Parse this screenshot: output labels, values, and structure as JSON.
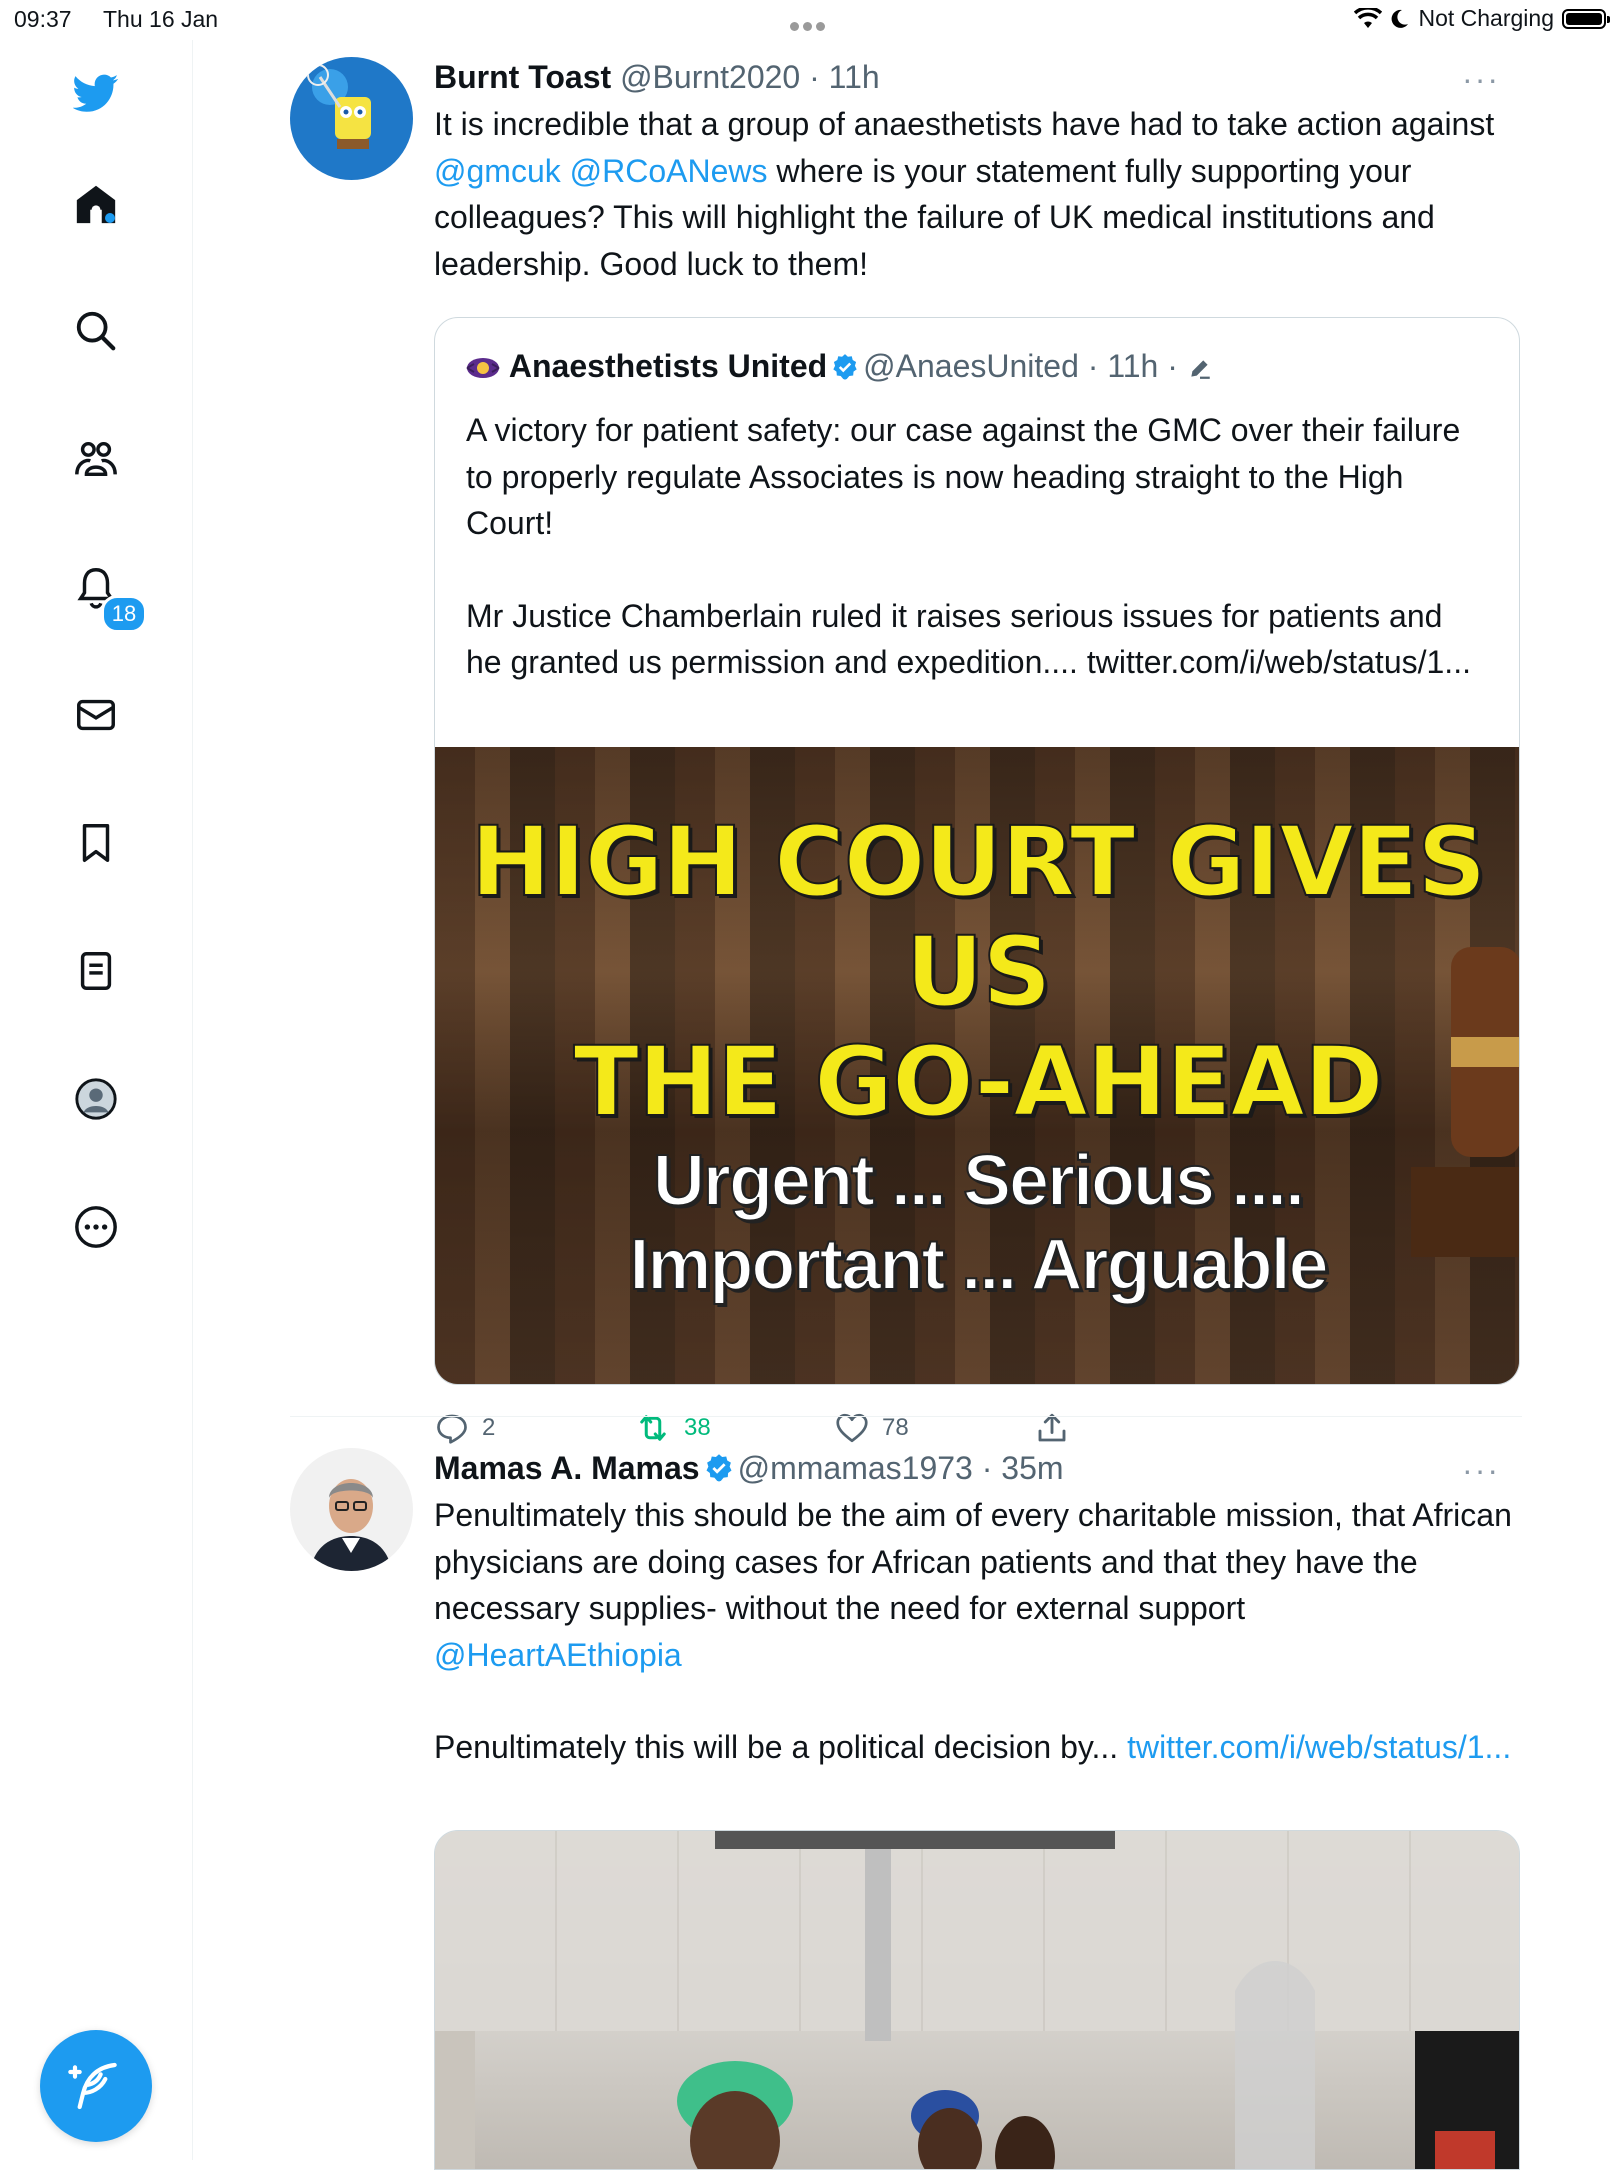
{
  "status_bar": {
    "time": "09:37",
    "date": "Thu 16 Jan",
    "charging": "Not Charging"
  },
  "sidebar": {
    "items": [
      {
        "icon": "twitter-bird-icon"
      },
      {
        "icon": "home-icon"
      },
      {
        "icon": "search-icon"
      },
      {
        "icon": "communities-icon"
      },
      {
        "icon": "notifications-icon",
        "badge": "18"
      },
      {
        "icon": "messages-icon"
      },
      {
        "icon": "bookmarks-icon"
      },
      {
        "icon": "lists-icon"
      },
      {
        "icon": "profile-icon"
      },
      {
        "icon": "more-icon"
      }
    ],
    "compose_icon": "compose-feather-icon"
  },
  "tweets": [
    {
      "name": "Burnt Toast",
      "handle": "@Burnt2020",
      "time": "11h",
      "text_parts": [
        "It is incredible that a group of anaesthetists have had to take action against ",
        "@gmcuk",
        " ",
        "@RCoANews",
        " where is your statement fully supporting your colleagues? This will highlight the failure of UK medical institutions and leadership. Good luck to them!"
      ],
      "quote": {
        "name": "Anaesthetists United",
        "handle": "@AnaesUnited",
        "time": "11h",
        "para1": "A victory for patient safety: our case against the GMC over their failure to properly regulate Associates is now heading straight to the High Court!",
        "para2": "Mr Justice Chamberlain ruled it raises serious issues for patients and he granted us permission and expedition.... twitter.com/i/web/status/1...",
        "image_headline_1": "HIGH COURT GIVES US",
        "image_headline_2": "THE GO-AHEAD",
        "image_sub_1": "Urgent ... Serious ....",
        "image_sub_2": "Important ... Arguable"
      },
      "replies": "2",
      "retweets": "38",
      "likes": "78"
    },
    {
      "name": "Mamas A. Mamas",
      "handle": "@mmamas1973",
      "time": "35m",
      "text_1": "Penultimately this should be the aim of every  charitable mission, that African physicians are doing cases for African patients and that they have the necessary supplies- without the need for external support",
      "mention": "@HeartAEthiopia",
      "text_2": "Penultimately this will be a political decision by...",
      "link": "twitter.com/i/web/status/1..."
    }
  ],
  "colors": {
    "accent": "#1d9bf0",
    "retweet": "#00ba7c",
    "text": "#0f1419",
    "secondary": "#536471"
  }
}
